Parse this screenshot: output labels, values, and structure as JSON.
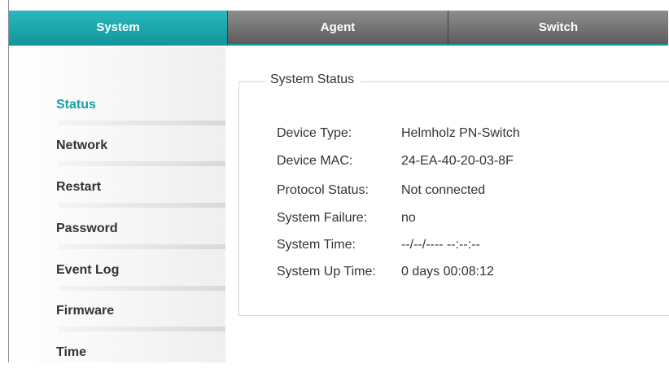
{
  "tabs": [
    {
      "label": "System",
      "active": true
    },
    {
      "label": "Agent",
      "active": false
    },
    {
      "label": "Switch",
      "active": false
    }
  ],
  "sidebar": {
    "items": [
      {
        "label": "Status",
        "active": true
      },
      {
        "label": "Network",
        "active": false
      },
      {
        "label": "Restart",
        "active": false
      },
      {
        "label": "Password",
        "active": false
      },
      {
        "label": "Event Log",
        "active": false
      },
      {
        "label": "Firmware",
        "active": false
      },
      {
        "label": "Time",
        "active": false
      }
    ]
  },
  "status_panel": {
    "legend": "System Status",
    "rows": [
      {
        "key": "Device Type:",
        "value": "Helmholz PN-Switch"
      },
      {
        "key": "Device MAC:",
        "value": "24-EA-40-20-03-8F"
      },
      {
        "key": "Protocol Status:",
        "value": "Not connected"
      },
      {
        "key": "System Failure:",
        "value": "no"
      },
      {
        "key": "System Time:",
        "value": "--/--/---- --:--:--"
      },
      {
        "key": "System Up Time:",
        "value": "0 days 00:08:12"
      }
    ]
  },
  "colors": {
    "accent": "#179ea4",
    "tab_inactive": "#6e6e6e",
    "text": "#333333"
  }
}
